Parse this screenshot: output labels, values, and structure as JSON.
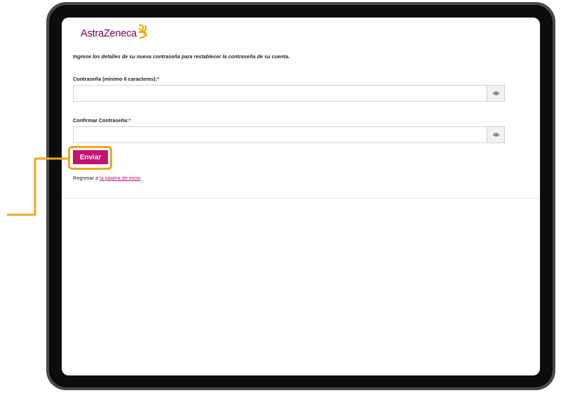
{
  "logo": {
    "text": "AstraZeneca"
  },
  "form": {
    "intro": "Ingrese los detalles de su nueva contraseña para restablecer la contraseña de su cuenta.",
    "password_label": "Contraseña (mínimo 6 caracteres):",
    "confirm_label": "Confirmar Contraseña:",
    "required_mark": "*",
    "password_value": "",
    "confirm_value": "",
    "submit_label": "Enviar",
    "back_prefix": "Regresar a ",
    "back_link": "la página de inicio"
  },
  "colors": {
    "brand": "#83004f",
    "accent": "#c4126f",
    "logo_mark": "#f0ab00",
    "highlight": "#e9a91c"
  },
  "icons": [
    "eye-icon",
    "eye-icon"
  ]
}
